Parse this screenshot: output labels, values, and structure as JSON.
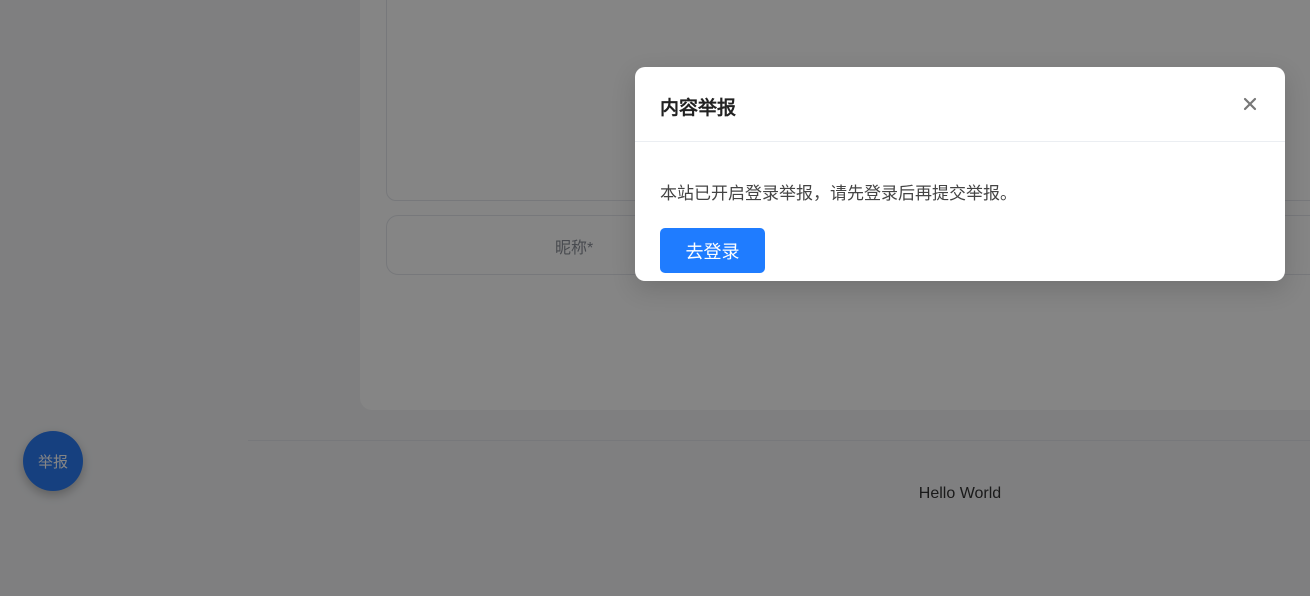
{
  "form": {
    "nickname_placeholder": "昵称*"
  },
  "footer": {
    "text": "Hello World"
  },
  "fab": {
    "label": "举报"
  },
  "modal": {
    "title": "内容举报",
    "message": "本站已开启登录举报，请先登录后再提交举报。",
    "login_button": "去登录",
    "close_icon": "close-icon"
  },
  "colors": {
    "accent": "#1f7cff",
    "fab": "#2b7cf3"
  }
}
